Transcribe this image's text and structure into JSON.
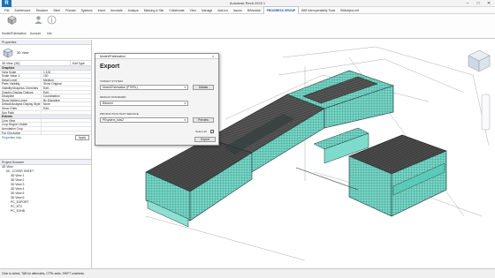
{
  "window": {
    "title": "Autodesk Revit 2022.1"
  },
  "menus": [
    "File",
    "Architecture",
    "Structure",
    "Steel",
    "Precast",
    "Systems",
    "Insert",
    "Annotate",
    "Analyze",
    "Massing & Site",
    "Collaborate",
    "View",
    "Manage",
    "Add-Ins",
    "Issues",
    "BIMcollab",
    "PROGRESS GROUP",
    "BIM Interoperability Tools",
    "BIMobject.net"
  ],
  "active_menu": "PROGRESS GROUP",
  "ribbon": {
    "buttons": [
      {
        "label": "Model2Fabrication",
        "icon": "export-cube-icon"
      },
      {
        "label": "Account",
        "icon": "account-icon"
      },
      {
        "label": "Info",
        "icon": "info-icon"
      }
    ]
  },
  "properties": {
    "title": "Properties",
    "view_type": "3D View",
    "type_selector": "3D View: {3D}",
    "edit_type": "Edit Type",
    "category": "Graphics",
    "rows": [
      {
        "k": "View Scale",
        "v": "1:100"
      },
      {
        "k": "Scale Value 1:",
        "v": "100"
      },
      {
        "k": "Detail Level",
        "v": "Medium"
      },
      {
        "k": "Parts Visibility",
        "v": "Show Original"
      },
      {
        "k": "Visibility/Graphics Overrides",
        "v": "Edit..."
      },
      {
        "k": "Graphic Display Options",
        "v": "Edit..."
      },
      {
        "k": "Discipline",
        "v": "Coordination"
      },
      {
        "k": "Show Hidden Lines",
        "v": "By Discipline"
      },
      {
        "k": "Default Analysis Display Style",
        "v": "None"
      },
      {
        "k": "Show Grids",
        "v": "Edit..."
      },
      {
        "k": "Sun Path",
        "v": ""
      }
    ],
    "extents_category": "Extents",
    "extents_rows": [
      {
        "k": "Crop View",
        "v": ""
      },
      {
        "k": "Crop Region Visible",
        "v": ""
      },
      {
        "k": "Annotation Crop",
        "v": ""
      },
      {
        "k": "Far Clip Active",
        "v": ""
      }
    ],
    "help_link": "Properties help",
    "apply": "Apply"
  },
  "project_browser": {
    "title": "Project Browser",
    "items": [
      {
        "label": "3D View",
        "indent": 0
      },
      {
        "label": "00 - COVER SHEET",
        "indent": 1
      },
      {
        "label": "3D View 1",
        "indent": 2
      },
      {
        "label": "3D View 2",
        "indent": 2
      },
      {
        "label": "3D View 3",
        "indent": 2
      },
      {
        "label": "3D View 4",
        "indent": 2
      },
      {
        "label": "3D View 5",
        "indent": 2
      },
      {
        "label": "3D View 6",
        "indent": 2
      },
      {
        "label": "PC_EXPORT",
        "indent": 2
      },
      {
        "label": "PC_ETC",
        "indent": 2
      },
      {
        "label": "PC_EXHB",
        "indent": 2
      }
    ]
  },
  "dialog": {
    "window_title": "Model2Fabrication",
    "heading": "Export",
    "target_system_label": "TARGET SYSTEM",
    "target_system_value": "Model2Fabrication (PTRRL)",
    "details_button": "Details",
    "design_standard_label": "DESIGN STANDARD",
    "design_standard_value": "Biboxed",
    "production_test_label": "PRODUCTION TEST SERVICE",
    "production_test_value": "PEsystem_tubs2",
    "preview_button": "Preview",
    "select_all_label": "Select all",
    "export_button": "Export"
  },
  "statusbar": {
    "text": "Click to select, TAB for alternates, CTRL adds, SHIFT unselects."
  },
  "colors": {
    "model_fill": "#6fd3c3",
    "model_line": "#1e3a38",
    "roof_dark": "#3b3b3b",
    "accent": "#1f6fb5"
  }
}
